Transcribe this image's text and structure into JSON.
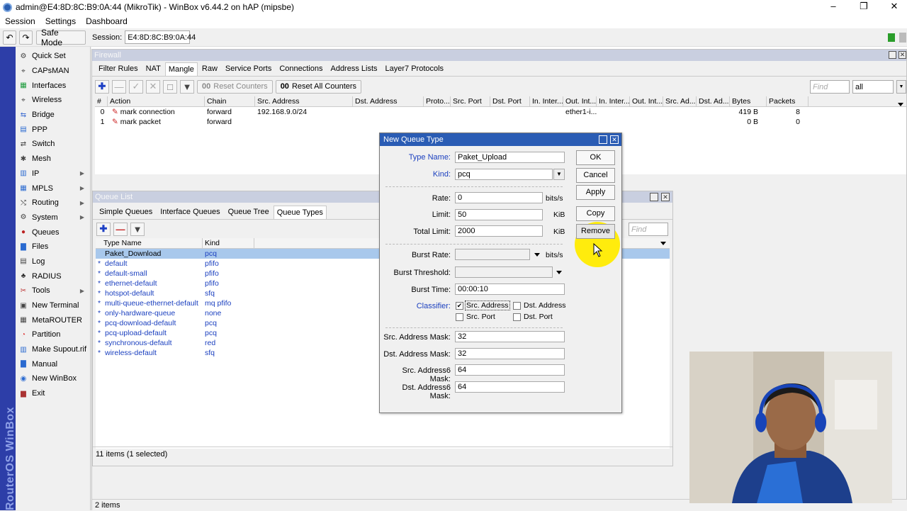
{
  "window": {
    "title": "admin@E4:8D:8C:B9:0A:44 (MikroTik) - WinBox v6.44.2 on hAP (mipsbe)"
  },
  "menu": [
    "Session",
    "Settings",
    "Dashboard"
  ],
  "toolbar": {
    "safe_mode": "Safe Mode",
    "session_label": "Session:",
    "session_value": "E4:8D:8C:B9:0A:44"
  },
  "sidebar": {
    "brand": "RouterOS WinBox",
    "items": [
      {
        "label": "Quick Set",
        "icon": "quick-set-icon",
        "arrow": false
      },
      {
        "label": "CAPsMAN",
        "icon": "capsman-icon",
        "arrow": false
      },
      {
        "label": "Interfaces",
        "icon": "interfaces-icon",
        "arrow": false
      },
      {
        "label": "Wireless",
        "icon": "wireless-icon",
        "arrow": false
      },
      {
        "label": "Bridge",
        "icon": "bridge-icon",
        "arrow": false
      },
      {
        "label": "PPP",
        "icon": "ppp-icon",
        "arrow": false
      },
      {
        "label": "Switch",
        "icon": "switch-icon",
        "arrow": false
      },
      {
        "label": "Mesh",
        "icon": "mesh-icon",
        "arrow": false
      },
      {
        "label": "IP",
        "icon": "ip-icon",
        "arrow": true
      },
      {
        "label": "MPLS",
        "icon": "mpls-icon",
        "arrow": true
      },
      {
        "label": "Routing",
        "icon": "routing-icon",
        "arrow": true
      },
      {
        "label": "System",
        "icon": "system-icon",
        "arrow": true
      },
      {
        "label": "Queues",
        "icon": "queues-icon",
        "arrow": false
      },
      {
        "label": "Files",
        "icon": "files-icon",
        "arrow": false
      },
      {
        "label": "Log",
        "icon": "log-icon",
        "arrow": false
      },
      {
        "label": "RADIUS",
        "icon": "radius-icon",
        "arrow": false
      },
      {
        "label": "Tools",
        "icon": "tools-icon",
        "arrow": true
      },
      {
        "label": "New Terminal",
        "icon": "terminal-icon",
        "arrow": false
      },
      {
        "label": "MetaROUTER",
        "icon": "metarouter-icon",
        "arrow": false
      },
      {
        "label": "Partition",
        "icon": "partition-icon",
        "arrow": false
      },
      {
        "label": "Make Supout.rif",
        "icon": "supout-icon",
        "arrow": false
      },
      {
        "label": "Manual",
        "icon": "manual-icon",
        "arrow": false
      },
      {
        "label": "New WinBox",
        "icon": "winbox-icon",
        "arrow": false
      },
      {
        "label": "Exit",
        "icon": "exit-icon",
        "arrow": false
      }
    ]
  },
  "firewall": {
    "title": "Firewall",
    "tabs": [
      "Filter Rules",
      "NAT",
      "Mangle",
      "Raw",
      "Service Ports",
      "Connections",
      "Address Lists",
      "Layer7 Protocols"
    ],
    "active_tab": "Mangle",
    "reset_counters": "Reset Counters",
    "reset_all_counters": "Reset All Counters",
    "find_placeholder": "Find",
    "filter_value": "all",
    "columns": [
      "#",
      "Action",
      "Chain",
      "Src. Address",
      "Dst. Address",
      "Proto...",
      "Src. Port",
      "Dst. Port",
      "In. Inter...",
      "Out. Int...",
      "In. Inter...",
      "Out. Int...",
      "Src. Ad...",
      "Dst. Ad...",
      "Bytes",
      "Packets"
    ],
    "rows": [
      {
        "num": "0",
        "action": "mark connection",
        "chain": "forward",
        "src": "192.168.9.0/24",
        "out_int": "ether1-i...",
        "bytes": "419 B",
        "packets": "8"
      },
      {
        "num": "1",
        "action": "mark packet",
        "chain": "forward",
        "src": "",
        "out_int": "",
        "bytes": "0 B",
        "packets": "0"
      }
    ],
    "status": "2 items"
  },
  "queue_list": {
    "title": "Queue List",
    "tabs": [
      "Simple Queues",
      "Interface Queues",
      "Queue Tree",
      "Queue Types"
    ],
    "active_tab": "Queue Types",
    "find_placeholder": "Find",
    "columns": [
      "Type Name",
      "Kind"
    ],
    "rows": [
      {
        "name": "Paket_Download",
        "kind": "pcq",
        "selected": true,
        "default": false
      },
      {
        "name": "default",
        "kind": "pfifo",
        "selected": false,
        "default": true
      },
      {
        "name": "default-small",
        "kind": "pfifo",
        "selected": false,
        "default": true
      },
      {
        "name": "ethernet-default",
        "kind": "pfifo",
        "selected": false,
        "default": true
      },
      {
        "name": "hotspot-default",
        "kind": "sfq",
        "selected": false,
        "default": true
      },
      {
        "name": "multi-queue-ethernet-default",
        "kind": "mq pfifo",
        "selected": false,
        "default": true
      },
      {
        "name": "only-hardware-queue",
        "kind": "none",
        "selected": false,
        "default": true
      },
      {
        "name": "pcq-download-default",
        "kind": "pcq",
        "selected": false,
        "default": true
      },
      {
        "name": "pcq-upload-default",
        "kind": "pcq",
        "selected": false,
        "default": true
      },
      {
        "name": "synchronous-default",
        "kind": "red",
        "selected": false,
        "default": true
      },
      {
        "name": "wireless-default",
        "kind": "sfq",
        "selected": false,
        "default": true
      }
    ],
    "status": "11 items (1 selected)"
  },
  "dialog": {
    "title": "New Queue Type",
    "type_name_label": "Type Name:",
    "type_name": "Paket_Upload",
    "kind_label": "Kind:",
    "kind": "pcq",
    "rate_label": "Rate:",
    "rate": "0",
    "rate_unit": "bits/s",
    "limit_label": "Limit:",
    "limit": "50",
    "limit_unit": "KiB",
    "total_limit_label": "Total Limit:",
    "total_limit": "2000",
    "total_limit_unit": "KiB",
    "burst_rate_label": "Burst Rate:",
    "burst_rate_unit": "bits/s",
    "burst_threshold_label": "Burst Threshold:",
    "burst_time_label": "Burst Time:",
    "burst_time": "00:00:10",
    "classifier_label": "Classifier:",
    "classifier": [
      {
        "label": "Src. Address",
        "checked": true
      },
      {
        "label": "Dst. Address",
        "checked": false
      },
      {
        "label": "Src. Port",
        "checked": false
      },
      {
        "label": "Dst. Port",
        "checked": false
      }
    ],
    "src_mask_label": "Src. Address Mask:",
    "src_mask": "32",
    "dst_mask_label": "Dst. Address Mask:",
    "dst_mask": "32",
    "src6_mask_label": "Src. Address6 Mask:",
    "src6_mask": "64",
    "dst6_mask_label": "Dst. Address6 Mask:",
    "dst6_mask": "64",
    "buttons": {
      "ok": "OK",
      "cancel": "Cancel",
      "apply": "Apply",
      "copy": "Copy",
      "remove": "Remove"
    }
  },
  "colors": {
    "sidebar_strip": "#2d3ea8",
    "dialog_title": "#2a5cb4",
    "selection": "#a8c8ec",
    "highlight_cursor": "#ffeb00"
  }
}
